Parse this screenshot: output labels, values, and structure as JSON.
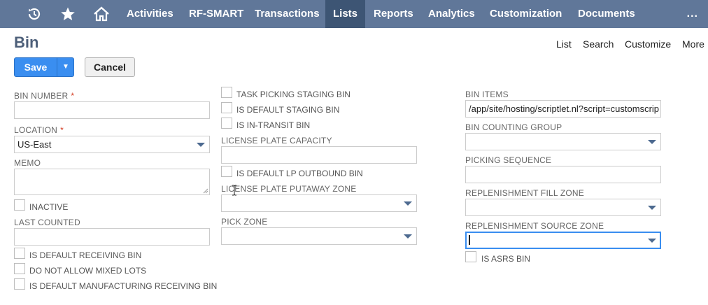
{
  "nav": {
    "icons": [
      "recent-history-icon",
      "star-icon",
      "home-icon"
    ],
    "items": [
      {
        "label": "Activities"
      },
      {
        "label": "RF-SMART"
      },
      {
        "label": "Transactions"
      },
      {
        "label": "Lists",
        "active": true
      },
      {
        "label": "Reports"
      },
      {
        "label": "Analytics"
      },
      {
        "label": "Customization"
      },
      {
        "label": "Documents"
      }
    ],
    "more": "..."
  },
  "header": {
    "title": "Bin",
    "links": [
      "List",
      "Search",
      "Customize",
      "More"
    ]
  },
  "buttons": {
    "save": "Save",
    "cancel": "Cancel"
  },
  "form": {
    "bin_number": {
      "label": "BIN NUMBER",
      "required_mark": "*",
      "value": ""
    },
    "location": {
      "label": "LOCATION",
      "required_mark": "*",
      "value": "US-East"
    },
    "memo": {
      "label": "MEMO",
      "value": ""
    },
    "inactive": {
      "label": "INACTIVE",
      "checked": false
    },
    "last_counted": {
      "label": "LAST COUNTED",
      "value": ""
    },
    "is_default_receiving_bin": {
      "label": "IS DEFAULT RECEIVING BIN",
      "checked": false
    },
    "do_not_allow_mixed_lots": {
      "label": "DO NOT ALLOW MIXED LOTS",
      "checked": false
    },
    "is_default_manufacturing_receiving_bin": {
      "label": "IS DEFAULT MANUFACTURING RECEIVING BIN",
      "checked": false
    },
    "task_picking_staging_bin": {
      "label": "TASK PICKING STAGING BIN",
      "checked": false
    },
    "is_default_staging_bin": {
      "label": "IS DEFAULT STAGING BIN",
      "checked": false
    },
    "is_in_transit_bin": {
      "label": "IS IN-TRANSIT BIN",
      "checked": false
    },
    "license_plate_capacity": {
      "label": "LICENSE PLATE CAPACITY",
      "value": ""
    },
    "is_default_lp_outbound_bin": {
      "label": "IS DEFAULT LP OUTBOUND BIN",
      "checked": false
    },
    "license_plate_putaway_zone": {
      "label": "LICENSE PLATE PUTAWAY ZONE",
      "value": ""
    },
    "pick_zone": {
      "label": "PICK ZONE",
      "value": ""
    },
    "bin_items": {
      "label": "BIN ITEMS",
      "value": "/app/site/hosting/scriptlet.nl?script=customscrip"
    },
    "bin_counting_group": {
      "label": "BIN COUNTING GROUP",
      "value": ""
    },
    "picking_sequence": {
      "label": "PICKING SEQUENCE",
      "value": ""
    },
    "replenishment_fill_zone": {
      "label": "REPLENISHMENT FILL ZONE",
      "value": ""
    },
    "replenishment_source_zone": {
      "label": "REPLENISHMENT SOURCE ZONE",
      "value": ""
    },
    "is_asrs_bin": {
      "label": "IS ASRS BIN",
      "checked": false
    }
  },
  "colors": {
    "nav_bg": "#607799",
    "nav_active": "#3d5574",
    "title": "#4d5f79",
    "primary_button": "#3a8ef0",
    "required": "#d33a1f",
    "focus_border": "#3a8ef0"
  }
}
